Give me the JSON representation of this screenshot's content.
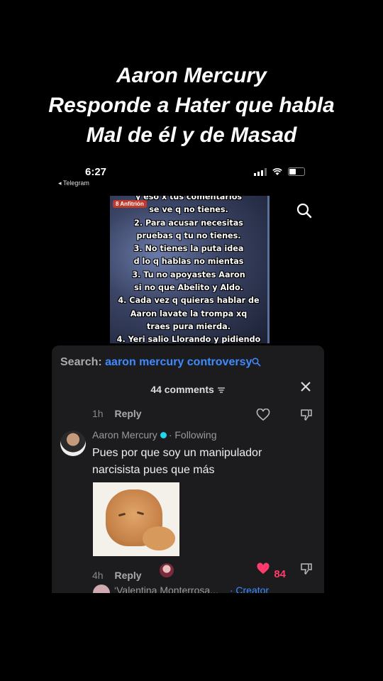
{
  "overlay_title": {
    "line1": "Aaron Mercury",
    "line2": "Responde a Hater que habla",
    "line3": "Mal de él y de Masad"
  },
  "status_bar": {
    "time": "6:27",
    "back_label": "◂ Telegram"
  },
  "meme_image": {
    "badge": "8 Anfitrión",
    "lines": [
      "y eso x tus comentarios",
      "se ve q no tienes.",
      "2. Para acusar necesitas",
      "pruebas q tu no tienes.",
      "3. No tienes la puta idea",
      "d lo q hablas no mientas",
      "3. Tu no apoyastes Aaron",
      "si no que Abelito y Aldo.",
      "4. Cada vez q quieras hablar de",
      "Aaron lavate la trompa xq",
      "traes pura mierda.",
      "4. Yeri salio Llorando y pidiendo"
    ]
  },
  "comments_panel": {
    "search_prefix": "Search:",
    "search_query": "aaron mercury controversy",
    "count_label": "44 comments",
    "prev_comment": {
      "age": "1h",
      "reply": "Reply"
    },
    "comment": {
      "author": "Aaron Mercury",
      "following": "· Following",
      "text": "Pues por que soy un manipulador narcisista pues que más",
      "age": "4h",
      "reply": "Reply",
      "likes": "84"
    },
    "next_comment": {
      "author": "‘Valentina Monterrosa...",
      "badge": "· Creator"
    }
  },
  "colors": {
    "accent_blue": "#3d8bff",
    "like_red": "#ff3b6b",
    "verified_cyan": "#20d5ec"
  }
}
